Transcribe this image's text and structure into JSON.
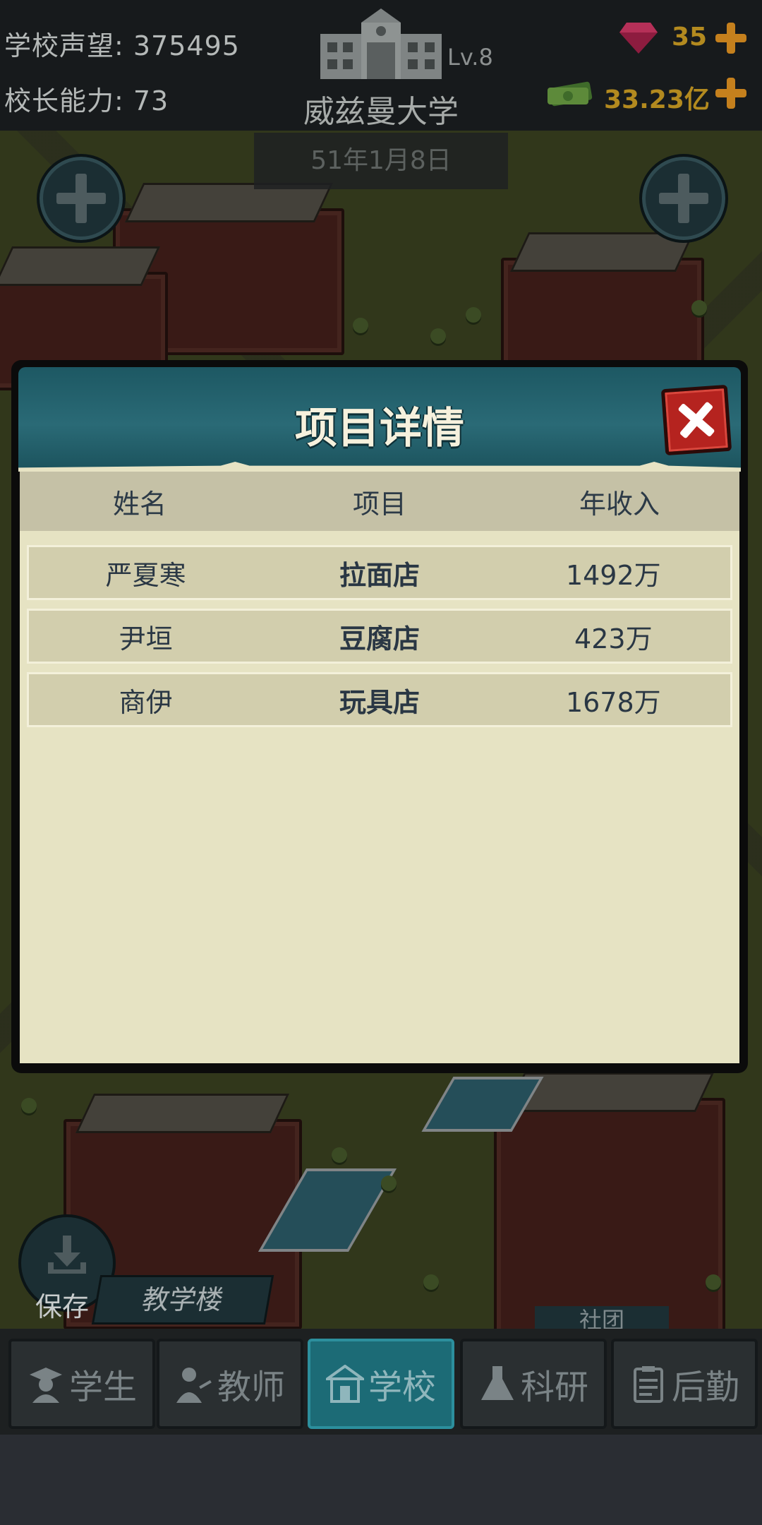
{
  "hud": {
    "reputation_label": "学校声望: 375495",
    "ability_label": "校长能力: 73",
    "level": "Lv.8",
    "school_name": "威兹曼大学",
    "gems": "35",
    "money": "33.23亿",
    "date": "51年1月8日"
  },
  "modal": {
    "title": "项目详情",
    "columns": [
      "姓名",
      "项目",
      "年收入"
    ],
    "rows": [
      {
        "name": "严夏寒",
        "project": "拉面店",
        "income": "1492万"
      },
      {
        "name": "尹垣",
        "project": "豆腐店",
        "income": "423万"
      },
      {
        "name": "商伊",
        "project": "玩具店",
        "income": "1678万"
      }
    ]
  },
  "map": {
    "save_label": "保存",
    "building_label": "教学楼",
    "building_label2": "社团"
  },
  "tabs": [
    {
      "label": "学生",
      "icon": "student-icon"
    },
    {
      "label": "教师",
      "icon": "teacher-icon"
    },
    {
      "label": "学校",
      "icon": "school-icon",
      "active": true
    },
    {
      "label": "科研",
      "icon": "flask-icon"
    },
    {
      "label": "后勤",
      "icon": "clipboard-icon"
    }
  ]
}
